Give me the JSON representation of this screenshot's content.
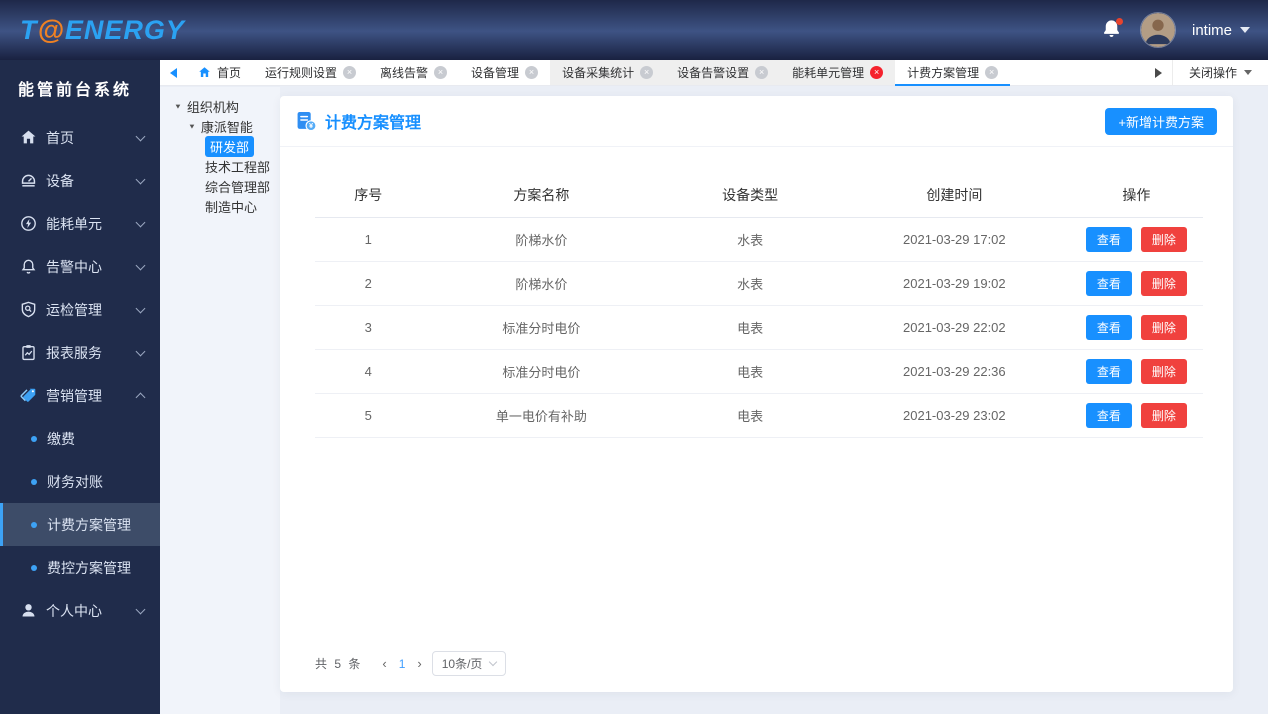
{
  "topbar": {
    "logo": {
      "t": "T",
      "at": "@",
      "energy": "ENERGY"
    },
    "username": "intime"
  },
  "sidebar": {
    "title": "能管前台系统",
    "items": [
      {
        "label": "首页",
        "icon": "home-icon"
      },
      {
        "label": "设备",
        "icon": "device-icon"
      },
      {
        "label": "能耗单元",
        "icon": "energy-unit-icon"
      },
      {
        "label": "告警中心",
        "icon": "alarm-icon"
      },
      {
        "label": "运检管理",
        "icon": "inspection-icon"
      },
      {
        "label": "报表服务",
        "icon": "report-icon"
      },
      {
        "label": "营销管理",
        "icon": "marketing-icon",
        "expanded": true
      },
      {
        "label": "个人中心",
        "icon": "user-icon"
      }
    ],
    "marketing_children": [
      {
        "label": "缴费"
      },
      {
        "label": "财务对账"
      },
      {
        "label": "计费方案管理",
        "active": true
      },
      {
        "label": "费控方案管理"
      }
    ]
  },
  "tabbar": {
    "tabs": [
      {
        "label": "首页"
      },
      {
        "label": "运行规则设置"
      },
      {
        "label": "离线告警"
      },
      {
        "label": "设备管理"
      },
      {
        "label": "设备采集统计"
      },
      {
        "label": "设备告警设置"
      },
      {
        "label": "能耗单元管理"
      },
      {
        "label": "计费方案管理",
        "active": true
      }
    ],
    "close_icon": "×",
    "close_menu_label": "关闭操作"
  },
  "tree": {
    "root": "组织机构",
    "company": "康派智能",
    "departments": [
      "研发部",
      "技术工程部",
      "综合管理部",
      "制造中心"
    ],
    "selected": "研发部"
  },
  "main": {
    "title": "计费方案管理",
    "add_button": "+新增计费方案",
    "table": {
      "headers": [
        "序号",
        "方案名称",
        "设备类型",
        "创建时间",
        "操作"
      ],
      "actions": {
        "view": "查看",
        "delete": "删除"
      },
      "rows": [
        {
          "index": "1",
          "name": "阶梯水价",
          "device_type": "水表",
          "created_at": "2021-03-29  17:02"
        },
        {
          "index": "2",
          "name": "阶梯水价",
          "device_type": "水表",
          "created_at": "2021-03-29  19:02"
        },
        {
          "index": "3",
          "name": "标准分时电价",
          "device_type": "电表",
          "created_at": "2021-03-29  22:02"
        },
        {
          "index": "4",
          "name": "标准分时电价",
          "device_type": "电表",
          "created_at": "2021-03-29  22:36"
        },
        {
          "index": "5",
          "name": "单一电价有补助",
          "device_type": "电表",
          "created_at": "2021-03-29  23:02"
        }
      ]
    },
    "pagination": {
      "total": "共 5 条",
      "prev": "‹",
      "page": "1",
      "next": "›",
      "page_size": "10条/页"
    }
  },
  "colors": {
    "accent": "#1890ff",
    "danger": "#f0413e",
    "sidebar_bg": "#202c4b",
    "logo_blue": "#2ba2f2",
    "logo_orange": "#ef8123"
  }
}
